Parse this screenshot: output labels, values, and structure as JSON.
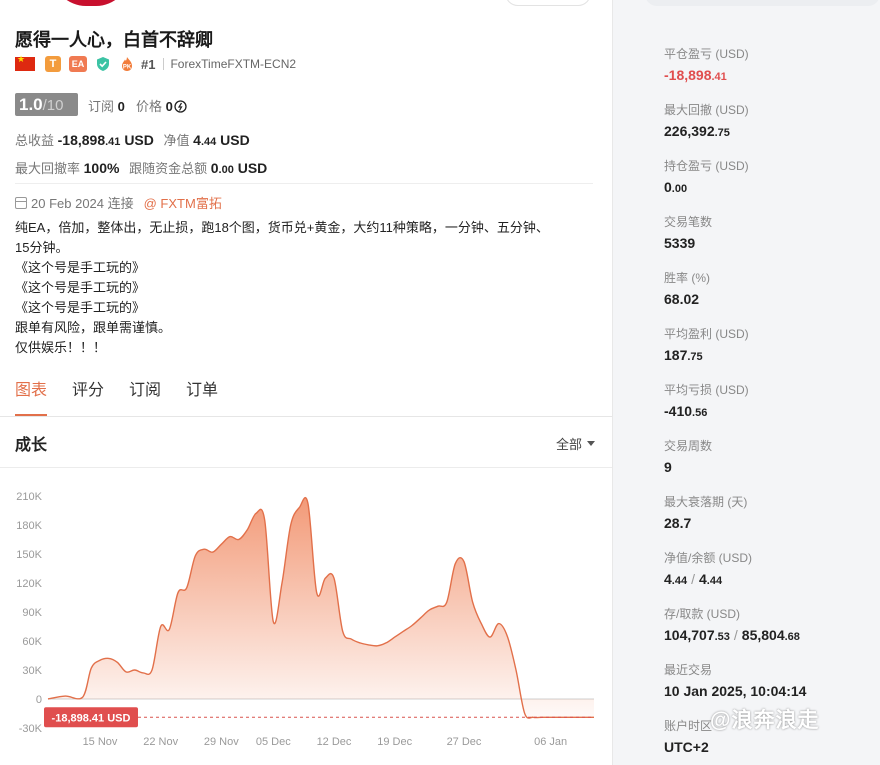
{
  "account": {
    "title": "愿得一人心，白首不辞卿",
    "badge_t": "T",
    "badge_ea": "EA",
    "badge_pk": "PK",
    "rank": "#1",
    "server": "ForexTimeFXTM-ECN2",
    "score": "1.0",
    "score_max": "/10",
    "subscribe_label": "订阅",
    "subscribe_count": "0",
    "price_label": "价格",
    "price_value": "0",
    "total_profit_label": "总收益",
    "total_profit_int": "-18,898",
    "total_profit_dec": ".41",
    "total_profit_unit": "USD",
    "equity_label": "净值",
    "equity_int": "4",
    "equity_dec": ".44",
    "equity_unit": "USD",
    "max_dd_label": "最大回撤率",
    "max_dd_value": "100%",
    "follow_label": "跟随资金总额",
    "follow_int": "0",
    "follow_dec": ".00",
    "follow_unit": "USD",
    "connected_date": "20 Feb 2024 连接",
    "broker": "@ FXTM富拓",
    "description": [
      "纯EA，倍加，整体出，无止损，跑18个图，货币兑+黄金，大约11种策略，一分钟、五分钟、",
      "15分钟。",
      "《这个号是手工玩的》",
      "《这个号是手工玩的》",
      "《这个号是手工玩的》",
      "跟单有风险，跟单需谨慎。",
      "仅供娱乐！！！"
    ]
  },
  "tabs": [
    {
      "label": "图表",
      "active": true
    },
    {
      "label": "评分",
      "active": false
    },
    {
      "label": "订阅",
      "active": false
    },
    {
      "label": "订单",
      "active": false
    }
  ],
  "growth": {
    "title": "成长",
    "range": "全部"
  },
  "chart_data": {
    "type": "area",
    "ylabel": "",
    "xlabel": "",
    "ylim": [
      -30000,
      210000
    ],
    "yticks": [
      "210K",
      "180K",
      "150K",
      "120K",
      "90K",
      "60K",
      "30K",
      "0",
      "-30K"
    ],
    "ytick_values": [
      210000,
      180000,
      150000,
      120000,
      90000,
      60000,
      30000,
      0,
      -30000
    ],
    "xticks": [
      "15 Nov",
      "22 Nov",
      "29 Nov",
      "05 Dec",
      "12 Dec",
      "19 Dec",
      "27 Dec",
      "06 Jan"
    ],
    "xtick_days": [
      15,
      22,
      29,
      35,
      42,
      49,
      57,
      67
    ],
    "current_label": "-18,898.41 USD",
    "current_value": -18898.41,
    "series": [
      {
        "x_days": [
          9,
          11,
          13,
          14,
          15,
          16,
          17,
          18,
          19,
          20,
          21,
          22,
          23,
          24,
          25,
          26,
          27,
          28,
          29,
          30,
          31,
          32,
          33,
          34,
          35,
          36,
          37,
          38,
          39,
          40,
          41,
          42,
          43,
          44,
          45,
          46,
          47,
          48,
          49,
          50,
          51,
          52,
          53,
          54,
          55,
          56,
          57,
          58,
          59,
          60,
          61,
          62,
          63,
          64,
          65,
          66,
          67,
          68,
          70,
          72
        ],
        "values": [
          0,
          3000,
          2000,
          32000,
          40000,
          42000,
          38000,
          28000,
          30000,
          27000,
          30000,
          75000,
          72000,
          110000,
          115000,
          148000,
          155000,
          152000,
          160000,
          168000,
          165000,
          175000,
          192000,
          185000,
          80000,
          120000,
          180000,
          198000,
          202000,
          110000,
          125000,
          125000,
          70000,
          62000,
          58000,
          56000,
          55000,
          58000,
          64000,
          70000,
          76000,
          84000,
          92000,
          96000,
          100000,
          140000,
          142000,
          100000,
          78000,
          64000,
          78000,
          65000,
          30000,
          -15000,
          -18898,
          -18898,
          -18898,
          -18898,
          -18898,
          -18898
        ]
      }
    ]
  },
  "metrics": [
    {
      "label": "平仓盈亏 (USD)",
      "int": "-18,898",
      "dec": ".41",
      "negative": true
    },
    {
      "label": "最大回撤 (USD)",
      "int": "226,392",
      "dec": ".75"
    },
    {
      "label": "持仓盈亏 (USD)",
      "int": "0",
      "dec": ".00"
    },
    {
      "label": "交易笔数",
      "int": "5339",
      "dec": ""
    },
    {
      "label": "胜率 (%)",
      "int": "68.02",
      "dec": ""
    },
    {
      "label": "平均盈利 (USD)",
      "int": "187",
      "dec": ".75"
    },
    {
      "label": "平均亏损 (USD)",
      "int": "-410",
      "dec": ".56"
    },
    {
      "label": "交易周数",
      "int": "9",
      "dec": ""
    },
    {
      "label": "最大衰落期 (天)",
      "int": "28.7",
      "dec": ""
    },
    {
      "label": "净值/余额 (USD)",
      "int": "4",
      "dec": ".44",
      "int2": "4",
      "dec2": ".44"
    },
    {
      "label": "存/取款 (USD)",
      "int": "104,707",
      "dec": ".53",
      "int2": "85,804",
      "dec2": ".68"
    },
    {
      "label": "最近交易",
      "int": "10 Jan 2025, 10:04:14",
      "dec": ""
    },
    {
      "label": "账户时区",
      "int": "UTC+2",
      "dec": ""
    }
  ],
  "watermark": "@浪奔浪走",
  "colors": {
    "accent": "#e2704a",
    "negative": "#e04e4e",
    "score_bg": "#8a8a8a"
  }
}
